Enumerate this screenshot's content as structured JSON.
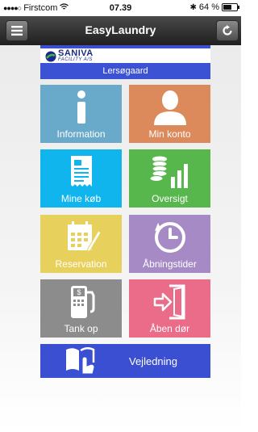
{
  "status": {
    "carrier": "Firstcom",
    "time": "07.39",
    "battery": "64 %",
    "battery_level": 0.64
  },
  "nav": {
    "title": "EasyLaundry"
  },
  "brand": {
    "logo_name": "SANIVA",
    "logo_sub": "FACILITY A/S",
    "location": "Lersøgaard"
  },
  "tiles": [
    {
      "label": "Information",
      "color": "#69a9c9",
      "icon": "info-icon"
    },
    {
      "label": "Min konto",
      "color": "#dc8a5b",
      "icon": "person-icon"
    },
    {
      "label": "Mine køb",
      "color": "#10b5ee",
      "icon": "receipt-icon"
    },
    {
      "label": "Oversigt",
      "color": "#57b64c",
      "icon": "coins-chart-icon"
    },
    {
      "label": "Reservation",
      "color": "#e8d05c",
      "icon": "calendar-icon"
    },
    {
      "label": "Åbningstider",
      "color": "#a58ac6",
      "icon": "clock-icon"
    },
    {
      "label": "Tank op",
      "color": "#8c8c8c",
      "icon": "fuel-pump-icon"
    },
    {
      "label": "Åben dør",
      "color": "#ea6c88",
      "icon": "door-enter-icon"
    }
  ],
  "guide": {
    "label": "Vejledning",
    "color": "#3a4fd1",
    "icon": "book-hand-icon"
  }
}
